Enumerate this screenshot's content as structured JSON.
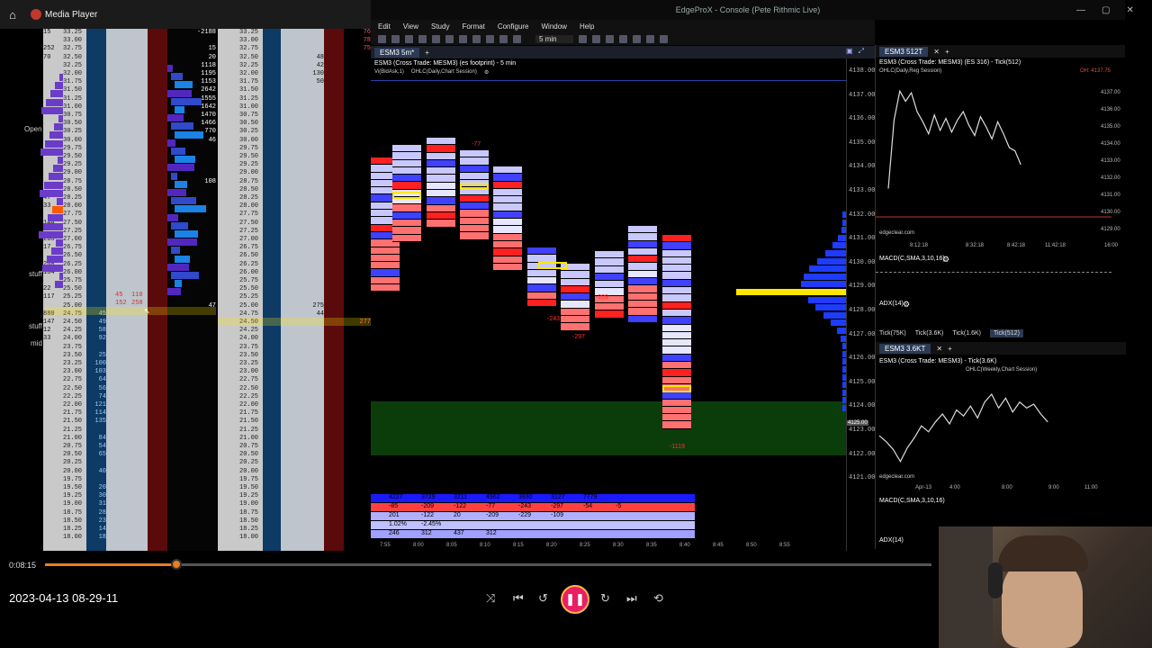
{
  "media_player": {
    "app_name": "Media Player",
    "home_icon": "home-icon",
    "time_elapsed": "0:08:15",
    "progress": 0.148,
    "video_title": "2023-04-13 08-29-11",
    "controls": [
      "shuffle-icon",
      "previous-icon",
      "rewind-10-icon",
      "pause-icon",
      "forward-30-icon",
      "next-icon",
      "repeat-icon"
    ]
  },
  "ladder_left": {
    "side_labels": {
      "open": "Open",
      "stuff1": "stuff",
      "stuff2": "stuff",
      "mid": "mid"
    },
    "prices": [
      "33.25",
      "33.00",
      "32.75",
      "32.50",
      "32.25",
      "32.00",
      "31.75",
      "31.50",
      "31.25",
      "31.00",
      "30.75",
      "30.50",
      "30.25",
      "30.00",
      "29.75",
      "29.50",
      "29.25",
      "29.00",
      "28.75",
      "28.50",
      "28.25",
      "28.00",
      "27.75",
      "27.50",
      "27.25",
      "27.00",
      "26.75",
      "26.50",
      "26.25",
      "26.00",
      "25.75",
      "25.50",
      "25.25",
      "25.00",
      "24.75",
      "24.50",
      "24.25",
      "24.00",
      "23.75",
      "23.50",
      "23.25",
      "23.00",
      "22.75",
      "22.50",
      "22.25",
      "22.00",
      "21.75",
      "21.50",
      "21.25",
      "21.00",
      "20.75",
      "20.50",
      "20.25",
      "20.00",
      "19.75",
      "19.50",
      "19.25",
      "19.00",
      "18.75",
      "18.50",
      "18.25",
      "18.00"
    ],
    "left_vol": [
      "15",
      "",
      "252",
      "70",
      "",
      "",
      "",
      "",
      "",
      "",
      "",
      "",
      "",
      "",
      "",
      "",
      "",
      "",
      "",
      "",
      "47",
      "33",
      "",
      "144",
      "",
      "263",
      "17",
      "",
      "268",
      "184",
      "",
      "22",
      "117",
      "",
      "880",
      "147",
      "12",
      "33"
    ],
    "bid": [
      "",
      "",
      "",
      "",
      "",
      "",
      "",
      "",
      "",
      "",
      "",
      "",
      "",
      "",
      "",
      "",
      "",
      "",
      "",
      "",
      "",
      "",
      "",
      "",
      "",
      "",
      "",
      "",
      "",
      "",
      "",
      "",
      "",
      "",
      "45",
      "49",
      "58",
      "92",
      "",
      "25",
      "100",
      "103",
      "64",
      "56",
      "74",
      "121",
      "114",
      "135",
      "",
      "84",
      "54",
      "65",
      "",
      "40",
      "",
      "20",
      "30",
      "31",
      "28",
      "23",
      "14",
      "18"
    ],
    "red_col": [
      "-2188",
      "",
      "15",
      "20",
      "1118",
      "1195",
      "1153",
      "2642",
      "1555",
      "1642",
      "1470",
      "1466",
      "770",
      "46",
      "",
      "",
      "",
      "",
      "108",
      "",
      "",
      "",
      "",
      "",
      "",
      "",
      "",
      "",
      "",
      "",
      "",
      "",
      "",
      "47"
    ],
    "cursor_values": [
      "45",
      "110",
      "152",
      "258"
    ]
  },
  "ladder_right": {
    "prices": [
      "33.25",
      "33.00",
      "32.75",
      "32.50",
      "32.25",
      "32.00",
      "31.75",
      "31.50",
      "31.25",
      "31.00",
      "30.75",
      "30.50",
      "30.25",
      "30.00",
      "29.75",
      "29.50",
      "29.25",
      "29.00",
      "28.75",
      "28.50",
      "28.25",
      "28.00",
      "27.75",
      "27.50",
      "27.25",
      "27.00",
      "26.75",
      "26.50",
      "26.25",
      "26.00",
      "25.75",
      "25.50",
      "25.25",
      "25.00",
      "24.75",
      "24.50",
      "24.25",
      "24.00",
      "23.75",
      "23.50",
      "23.25",
      "23.00",
      "22.75",
      "22.50",
      "22.25",
      "22.00",
      "21.75",
      "21.50",
      "21.25",
      "21.00",
      "20.75",
      "20.50",
      "20.25",
      "20.00",
      "19.75",
      "19.50",
      "19.25",
      "19.00",
      "18.75",
      "18.50",
      "18.25",
      "18.00"
    ],
    "vol": [
      "",
      "",
      "",
      "48",
      "42",
      "130",
      "50",
      "",
      "",
      "",
      "",
      "",
      "",
      "",
      "",
      "",
      "",
      "",
      "",
      "",
      "",
      "",
      "",
      "",
      "",
      "",
      "",
      "",
      "",
      "",
      "",
      "",
      "",
      "275",
      "44"
    ],
    "red_vol": [
      "76",
      "78",
      "75",
      "",
      "",
      "",
      "",
      "",
      "",
      "",
      "",
      "",
      "",
      "",
      "",
      "",
      "",
      "",
      "",
      "",
      "",
      "",
      "",
      "",
      "",
      "",
      "",
      "",
      "",
      "",
      "",
      "",
      "",
      "",
      "",
      "277"
    ]
  },
  "edgeprox": {
    "window_title": "EdgeProX - Console (Pete Rithmic Live)",
    "menu": [
      "Edit",
      "View",
      "Study",
      "Format",
      "Configure",
      "Window",
      "Help"
    ],
    "interval": "5 min",
    "main_tab": "ESM3 5m*",
    "main_chart_title": "ESM3 (Cross Trade: MESM3) (es footprint) - 5 min",
    "main_chart_studies": [
      "Vi(BidAsk,1)",
      "OHLC(Daily,Chart Session)"
    ],
    "price_ticks": [
      "4138.00",
      "4137.00",
      "4136.00",
      "4135.00",
      "4134.00",
      "4133.00",
      "4132.00",
      "4131.00",
      "4130.00",
      "4129.00",
      "4128.00",
      "4127.00",
      "4126.00",
      "4125.00",
      "4124.00",
      "4123.00",
      "4122.00",
      "4121.00"
    ],
    "price_labels": [
      "4137.75",
      "4125.00"
    ],
    "footprint_negative_labels": [
      "-77",
      "-243",
      "-297",
      "-209",
      "-1119"
    ],
    "delta_table": {
      "row1": [
        "4227",
        "3729",
        "3211",
        "4962",
        "3930",
        "3127",
        "7779"
      ],
      "row2": [
        "-85",
        "-209",
        "-122",
        "-77",
        "-243",
        "-297",
        "-54",
        "-5"
      ],
      "row3": [
        "201",
        "-122",
        "20",
        "-209",
        "-229",
        "-109"
      ],
      "row4": [
        "1.02%",
        "-2.45%"
      ],
      "row5": [
        "246",
        "312",
        "437",
        "312"
      ]
    },
    "time_axis": [
      "7:55",
      "8:00",
      "8:05",
      "8:10",
      "8:15",
      "8:20",
      "8:25",
      "8:30",
      "8:35",
      "8:40",
      "8:45",
      "8:50",
      "8:55"
    ]
  },
  "right_panel": {
    "top_tab": "ESM3 512T",
    "top_chart_title": "ESM3 (Cross Trade: MESM3) (ES 316) - Tick(512)",
    "top_chart_study": "OHLC(Daily,Reg Session)",
    "top_price_ticks": [
      "4137.00",
      "4136.00",
      "4135.00",
      "4134.00",
      "4133.00",
      "4132.00",
      "4131.00",
      "4130.00",
      "4129.00"
    ],
    "top_time_axis": [
      "8:12:18",
      "8:32:18",
      "8:42:18",
      "11:42:18",
      "16:00"
    ],
    "top_watermark": "edgeclear.com",
    "oh_label": "OH: 4137.75",
    "macd_label": "MACD(C,SMA,3,10,16)",
    "adx_label": "ADX(14)",
    "tick_tabs": [
      "Tick(75K)",
      "Tick(3.6K)",
      "Tick(1.6K)",
      "Tick(512)"
    ],
    "bottom_tab": "ESM3 3.6KT",
    "bottom_chart_title": "ESM3 (Cross Trade: MESM3) - Tick(3.6K)",
    "bottom_chart_study": "OHLC(Weekly,Chart Session)",
    "bottom_time_axis": [
      "Apr-13",
      "4:00",
      "8:00",
      "9:00",
      "11:00"
    ],
    "bottom_watermark": "edgeclear.com"
  },
  "colors": {
    "accent": "#e67e22",
    "pause": "#e91e63",
    "bid_blue": "#0d3b66",
    "ask_red": "#5a0a0a",
    "vp_blue": "#1e3cff",
    "poc_yellow": "#ffe600",
    "value_area_green": "#0b3d0b"
  }
}
